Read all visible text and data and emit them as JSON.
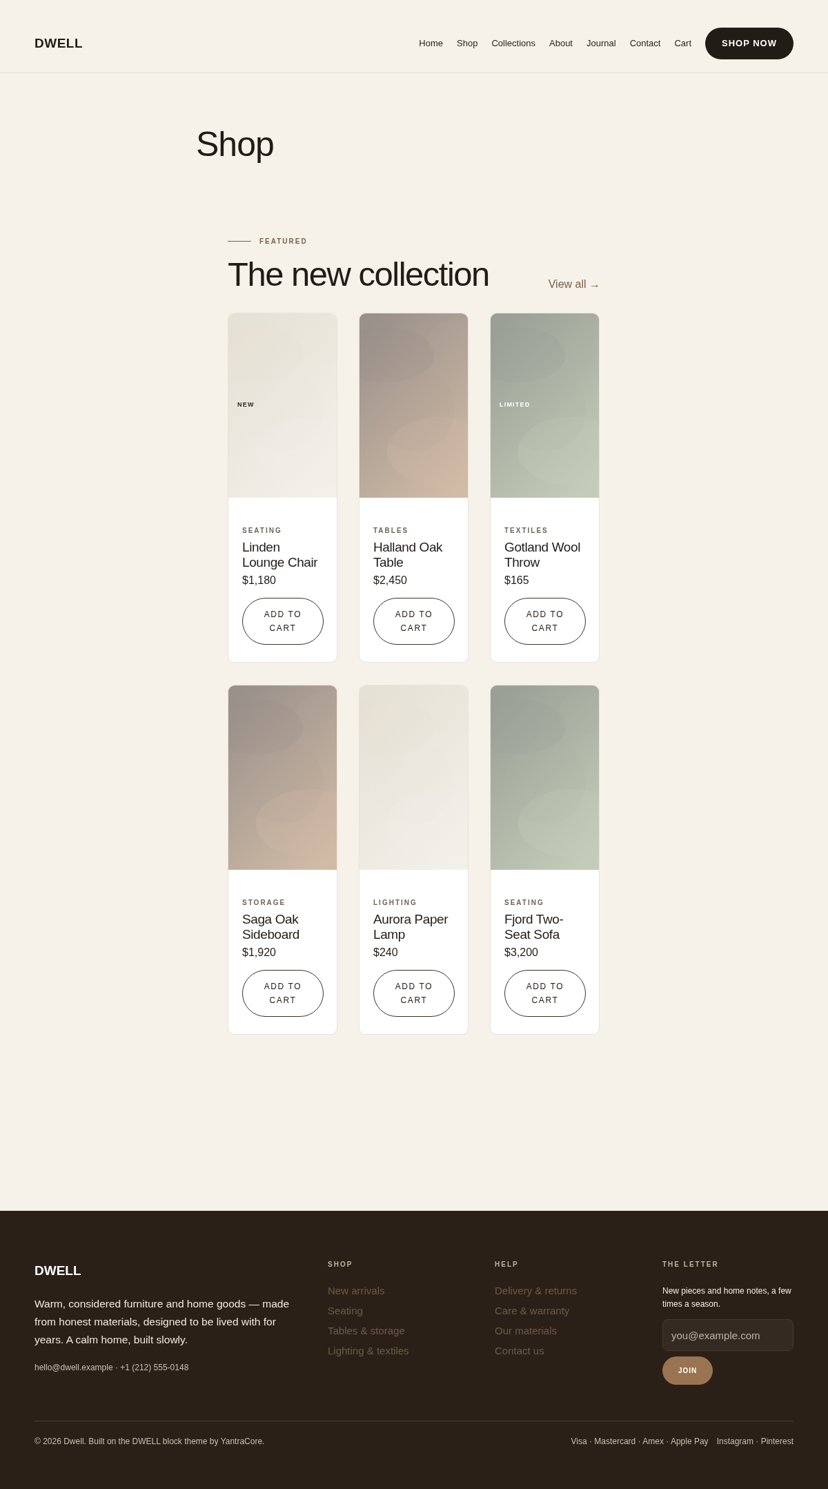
{
  "header": {
    "logo": "DWELL",
    "nav": [
      {
        "label": "Home"
      },
      {
        "label": "Shop"
      },
      {
        "label": "Collections"
      },
      {
        "label": "About"
      },
      {
        "label": "Journal"
      },
      {
        "label": "Contact"
      },
      {
        "label": "Cart"
      }
    ],
    "cta": "SHOP NOW"
  },
  "page_title": "Shop",
  "section": {
    "eyebrow": "FEATURED",
    "title": "The new collection",
    "view_all": "View all →"
  },
  "products": [
    {
      "kind": "cream",
      "badge": "NEW",
      "category": "SEATING",
      "name": "Linden Lounge Chair",
      "price": "$1,180",
      "button": "ADD TO CART"
    },
    {
      "kind": "taupe",
      "category": "TABLES",
      "name": "Halland Oak Table",
      "price": "$2,450",
      "button": "ADD TO CART"
    },
    {
      "kind": "sage",
      "badge": "LIMITED",
      "category": "TEXTILES",
      "name": "Gotland Wool Throw",
      "price": "$165",
      "button": "ADD TO CART"
    },
    {
      "kind": "taupe",
      "category": "STORAGE",
      "name": "Saga Oak Sideboard",
      "price": "$1,920",
      "button": "ADD TO CART"
    },
    {
      "kind": "cream",
      "category": "LIGHTING",
      "name": "Aurora Paper Lamp",
      "price": "$240",
      "button": "ADD TO CART"
    },
    {
      "kind": "sage",
      "category": "SEATING",
      "name": "Fjord Two-Seat Sofa",
      "price": "$3,200",
      "button": "ADD TO CART"
    }
  ],
  "footer": {
    "logo": "DWELL",
    "about": "Warm, considered furniture and home goods — made from honest materials, designed to be lived with for years. A calm home, built slowly.",
    "contact": "hello@dwell.example · +1 (212) 555-0148",
    "columns": [
      {
        "heading": "SHOP",
        "links": [
          "New arrivals",
          "Seating",
          "Tables & storage",
          "Lighting & textiles"
        ]
      },
      {
        "heading": "HELP",
        "links": [
          "Delivery & returns",
          "Care & warranty",
          "Our materials",
          "Contact us"
        ]
      }
    ],
    "newsletter": {
      "heading": "THE LETTER",
      "text": "New pieces and home notes, a few times a season.",
      "placeholder": "you@example.com",
      "button": "JOIN"
    },
    "copyright": "© 2026 Dwell. Built on the DWELL block theme by YantraCore.",
    "payments": "Visa · Mastercard · Amex · Apple Pay",
    "social": "Instagram · Pinterest"
  }
}
